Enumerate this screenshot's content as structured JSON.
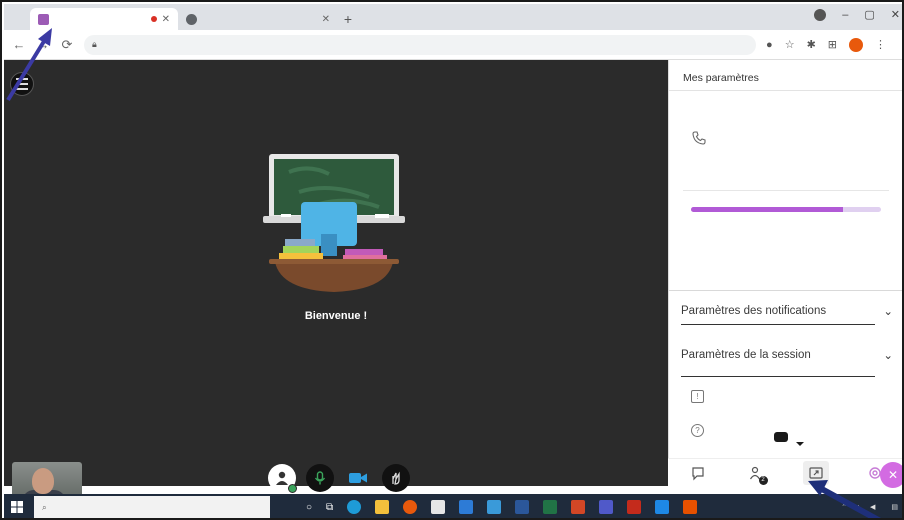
{
  "browser": {
    "tabs": [
      {
        "title": "",
        "favicon_color": "#9c5bb5",
        "recording": true
      },
      {
        "title": "",
        "favicon_color": "#5f6368",
        "recording": false
      }
    ],
    "url_host": "",
    "url_path": ""
  },
  "stage": {
    "welcome_title": "Bienvenue !",
    "welcome_line1": "",
    "welcome_line2": ""
  },
  "panel": {
    "header": "Mes paramètres",
    "prev_label": "",
    "phone_text": "",
    "speaker_label": "",
    "volume_min": "",
    "volume_max": "",
    "volume_level": 0.8,
    "echo_text": "",
    "notifications_label": "Paramètres des notifications",
    "session_label": "Paramètres de la session",
    "report_label": "",
    "chat_label": ""
  },
  "tooltip": {
    "text": ""
  },
  "taskbar": {
    "search_placeholder": "",
    "clock_time": "",
    "clock_date": ""
  },
  "colors": {
    "accent_purple": "#b15ad6",
    "fab_pink": "#d36be2",
    "stage_bg": "#2b2b2b",
    "annotation_arrow": "#3b3aa3"
  }
}
